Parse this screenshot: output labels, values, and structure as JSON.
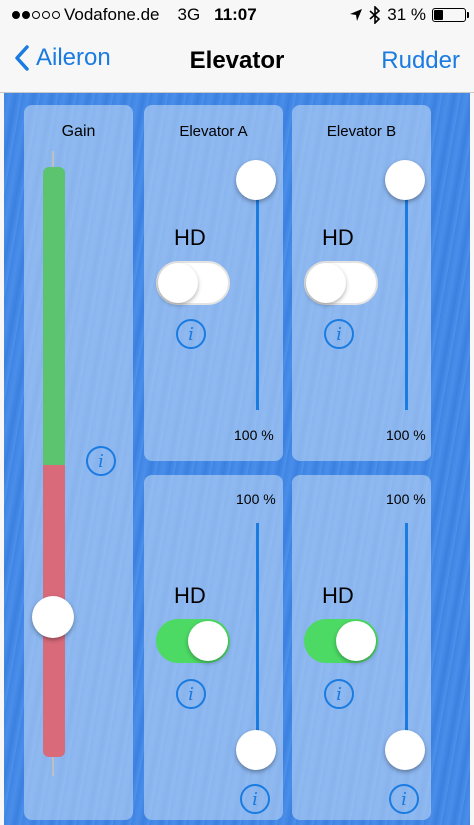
{
  "status": {
    "carrier": "Vodafone.de",
    "network": "3G",
    "time": "11:07",
    "battery_text": "31 %",
    "battery_level": 0.31,
    "signal_bars": [
      true,
      true,
      false,
      false,
      false
    ]
  },
  "nav": {
    "back_label": "Aileron",
    "title": "Elevator",
    "right_label": "Rudder"
  },
  "gain": {
    "title": "Gain",
    "info_glyph": "i",
    "value": 0.22
  },
  "panels": {
    "elevator_a_top": {
      "title": "Elevator A",
      "hd_label": "HD",
      "hd_on": false,
      "percent": "100 %",
      "info_glyph": "i"
    },
    "elevator_b_top": {
      "title": "Elevator B",
      "hd_label": "HD",
      "hd_on": false,
      "percent": "100 %",
      "info_glyph": "i"
    },
    "elevator_a_bottom": {
      "hd_label": "HD",
      "hd_on": true,
      "percent": "100 %",
      "info_glyph": "i"
    },
    "elevator_b_bottom": {
      "hd_label": "HD",
      "hd_on": true,
      "percent": "100 %",
      "info_glyph": "i"
    }
  },
  "colors": {
    "accent": "#1a7be0",
    "switch_on": "#4cd964",
    "gain_green": "#5cc46f",
    "gain_red": "#d86a7a",
    "background_blue": "#3f84e4"
  }
}
